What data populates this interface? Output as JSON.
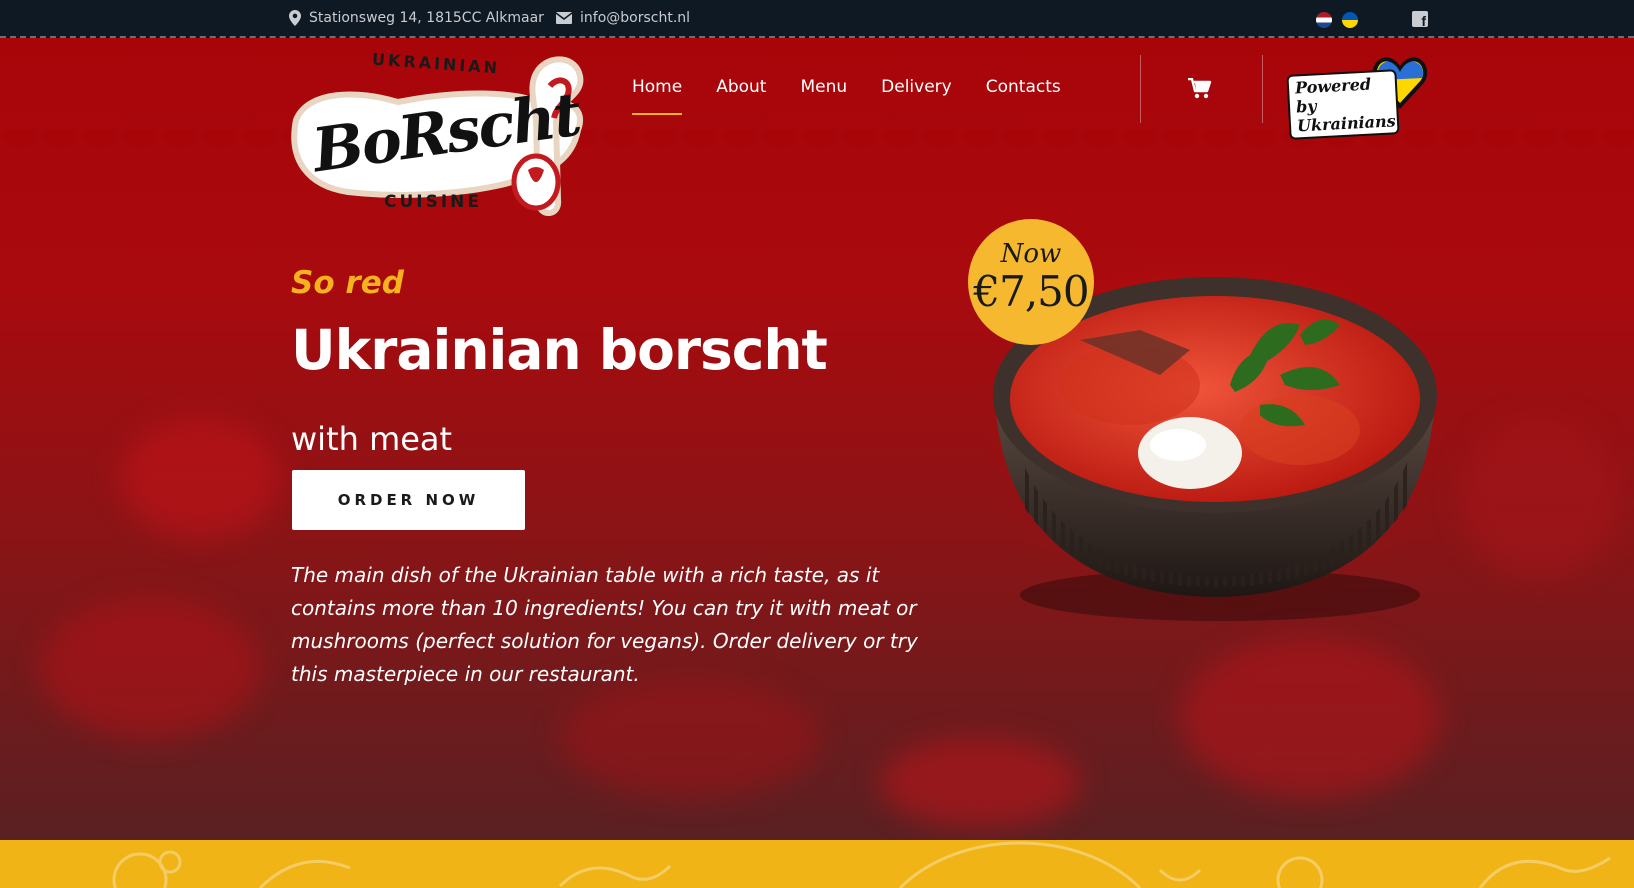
{
  "topbar": {
    "address": "Stationsweg 14, 1815CC Alkmaar",
    "email": "info@borscht.nl",
    "icons": [
      "location-pin-icon",
      "mail-icon",
      "flag-nl-icon",
      "flag-ua-icon",
      "facebook-icon"
    ]
  },
  "logo": {
    "top": "UKRAINIAN",
    "main": "BoRscht",
    "bottom": "CUISINE"
  },
  "nav": {
    "items": [
      {
        "label": "Home",
        "active": true
      },
      {
        "label": "About",
        "active": false
      },
      {
        "label": "Menu",
        "active": false
      },
      {
        "label": "Delivery",
        "active": false
      },
      {
        "label": "Contacts",
        "active": false
      }
    ],
    "cart_icon": "cart-icon"
  },
  "powered": {
    "line1": "Powered by",
    "line2": "Ukrainians"
  },
  "hero": {
    "tagline": "So red",
    "title": "Ukrainian borscht",
    "subtitle": "with meat",
    "order_button": "ORDER NOW",
    "description": "The main dish of the Ukrainian table with a rich taste, as it contains more than 10 ingredients! You can try it with meat or mushrooms (perfect solution for vegans). Order delivery or try this masterpiece in our restaurant."
  },
  "badge": {
    "now": "Now",
    "price": "€7,50"
  },
  "colors": {
    "topbar_bg": "#0f1923",
    "hero_red": "#a80509",
    "accent_yellow": "#f5b21e",
    "band_yellow": "#f0b417"
  }
}
